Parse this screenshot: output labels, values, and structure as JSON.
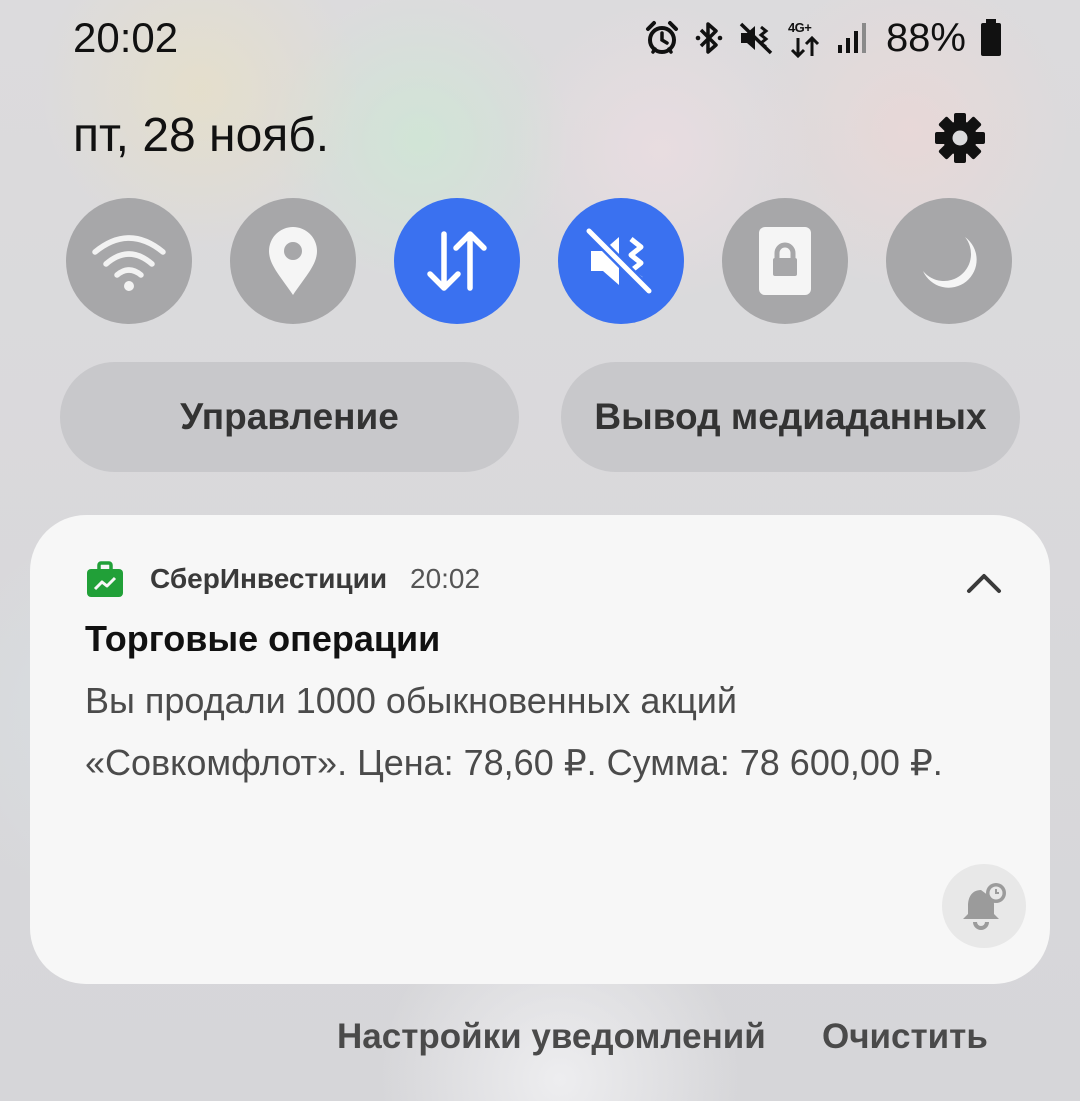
{
  "status_bar": {
    "time": "20:02",
    "icons": [
      "alarm-icon",
      "bluetooth-icon",
      "vibrate-mute-icon",
      "4g-plus-data-icon",
      "signal-icon",
      "battery-icon"
    ],
    "network_label": "4G+",
    "battery_percent": "88%"
  },
  "header": {
    "date": "пт, 28 нояб.",
    "settings_icon": "gear-icon"
  },
  "quick_tiles": [
    {
      "name": "wifi",
      "icon": "wifi-icon",
      "active": false
    },
    {
      "name": "location",
      "icon": "location-pin-icon",
      "active": false
    },
    {
      "name": "mobile-data",
      "icon": "data-transfer-icon",
      "active": true
    },
    {
      "name": "sound-mode",
      "icon": "vibrate-mute-icon",
      "active": true
    },
    {
      "name": "screen-lock",
      "icon": "lock-icon",
      "active": false
    },
    {
      "name": "dark-mode",
      "icon": "moon-icon",
      "active": false
    }
  ],
  "panel_buttons": {
    "device_control": "Управление",
    "media_output": "Вывод медиаданных"
  },
  "notification": {
    "app_name": "СберИнвестиции",
    "time": "20:02",
    "title": "Торговые операции",
    "body_line1": "Вы продали 1000 обыкновенных акций",
    "body_line2": "«Совкомфлот». Цена: 78,60 ₽. Сумма: 78 600,00 ₽."
  },
  "footer": {
    "notification_settings": "Настройки уведомлений",
    "clear": "Очистить"
  },
  "colors": {
    "tile_active": "#3a71f0",
    "tile_inactive": "#a7a7a9",
    "app_green": "#21a038",
    "card_bg": "#f7f7f7"
  }
}
